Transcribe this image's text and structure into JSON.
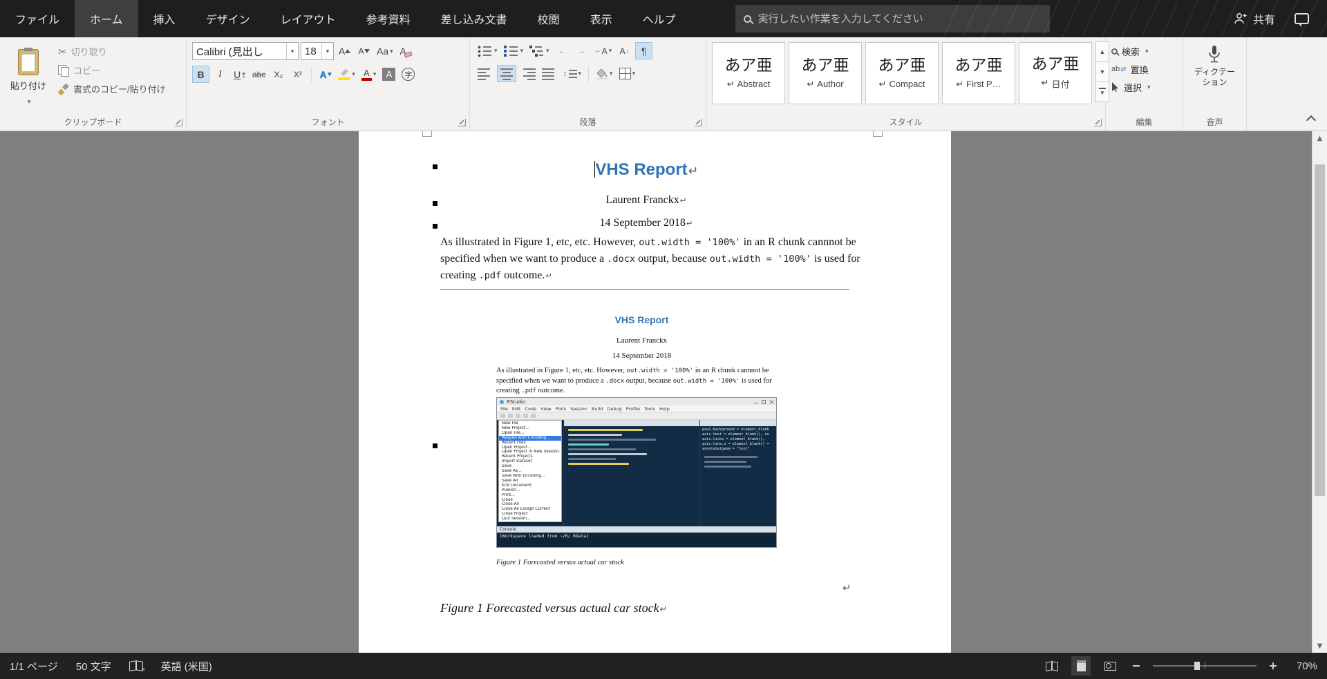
{
  "icons": {
    "cut": "✂",
    "grow_font": "A",
    "shrink_font": "A",
    "change_case": "Aa",
    "clear_format": "A",
    "bold": "B",
    "italic": "I",
    "underline": "U",
    "strikethrough": "abc",
    "subscript": "X₂",
    "superscript": "X²",
    "text_effects": "A",
    "highlight": "ab",
    "font_color": "A",
    "char_shading": "A",
    "enclose_char": "字",
    "ext_format": "A",
    "sort": "A",
    "pilcrow": "¶",
    "line_spacing": "↕",
    "replace": "ab",
    "scroll_up": "▲",
    "scroll_down": "▼"
  },
  "titlebar": {
    "tabs": [
      {
        "label": "ファイル"
      },
      {
        "label": "ホーム",
        "active": true
      },
      {
        "label": "挿入"
      },
      {
        "label": "デザイン"
      },
      {
        "label": "レイアウト"
      },
      {
        "label": "参考資料"
      },
      {
        "label": "差し込み文書"
      },
      {
        "label": "校閲"
      },
      {
        "label": "表示"
      },
      {
        "label": "ヘルプ"
      }
    ],
    "search_placeholder": "実行したい作業を入力してください",
    "share_label": "共有"
  },
  "ribbon": {
    "clipboard": {
      "group_label": "クリップボード",
      "paste_label": "貼り付け",
      "cut_label": "切り取り",
      "copy_label": "コピー",
      "format_painter_label": "書式のコピー/貼り付け"
    },
    "font": {
      "group_label": "フォント",
      "font_name": "Calibri (見出し",
      "font_size": "18"
    },
    "paragraph": {
      "group_label": "段落"
    },
    "styles": {
      "group_label": "スタイル",
      "preview": "あア亜",
      "mark": "↵",
      "items": [
        {
          "name": "Abstract"
        },
        {
          "name": "Author"
        },
        {
          "name": "Compact"
        },
        {
          "name": "First P…"
        },
        {
          "name": "日付"
        }
      ]
    },
    "editing": {
      "group_label": "編集",
      "find_label": "検索",
      "replace_label": "置換",
      "select_label": "選択"
    },
    "voice": {
      "group_label": "音声",
      "dictate_line1": "ディクテー",
      "dictate_line2": "ション"
    }
  },
  "document": {
    "title": "VHS Report",
    "author": "Laurent Franckx",
    "date": "14 September 2018",
    "eol_mark": "↵",
    "paragraph_segments": [
      {
        "text": "As illustrated in Figure 1, etc, etc. However, ",
        "code": false
      },
      {
        "text": "out.width = '100%'",
        "code": true
      },
      {
        "text": " in an R chunk cannnot be specified when we want to produce a ",
        "code": false
      },
      {
        "text": ".docx",
        "code": true
      },
      {
        "text": " output, because ",
        "code": false
      },
      {
        "text": "out.width = '100%'",
        "code": true
      },
      {
        "text": " is used for creating ",
        "code": false
      },
      {
        "text": ".pdf",
        "code": true
      },
      {
        "text": " outcome.",
        "code": false
      }
    ],
    "figure_caption": "Figure 1 Forecasted versus actual car stock"
  },
  "rstudio": {
    "window_title": "RStudio",
    "menus": [
      "File",
      "Edit",
      "Code",
      "View",
      "Plots",
      "Session",
      "Build",
      "Debug",
      "Profile",
      "Tools",
      "Help"
    ],
    "file_menu": [
      {
        "label": "New File"
      },
      {
        "label": "New Project..."
      },
      {
        "label": "Open File..."
      },
      {
        "label": "Reopen with Encoding...",
        "active": true
      },
      {
        "label": "Recent Files"
      },
      {
        "label": "Open Project..."
      },
      {
        "label": "Open Project in New Session..."
      },
      {
        "label": "Recent Projects"
      },
      {
        "label": "Import Dataset"
      },
      {
        "label": "Save"
      },
      {
        "label": "Save As..."
      },
      {
        "label": "Save with Encoding..."
      },
      {
        "label": "Save All"
      },
      {
        "label": "Knit Document"
      },
      {
        "label": "Publish..."
      },
      {
        "label": "Print..."
      },
      {
        "label": "Close"
      },
      {
        "label": "Close All"
      },
      {
        "label": "Close All Except Current"
      },
      {
        "label": "Close Project"
      },
      {
        "label": "Quit Session..."
      }
    ],
    "code_lines": [
      "pow1.background = element_blank",
      "axis.text = element_blank(), ax",
      "axis.ticks = element_blank(),",
      "axis.line.x = element_blank() =",
      "annotate(geom = \"text\""
    ],
    "console_tab": "Console",
    "console_line": "[Workspace loaded from ~/R/.RData]"
  },
  "statusbar": {
    "page_info": "1/1 ページ",
    "word_count": "50 文字",
    "language": "英語 (米国)",
    "zoom_level": "70%"
  }
}
